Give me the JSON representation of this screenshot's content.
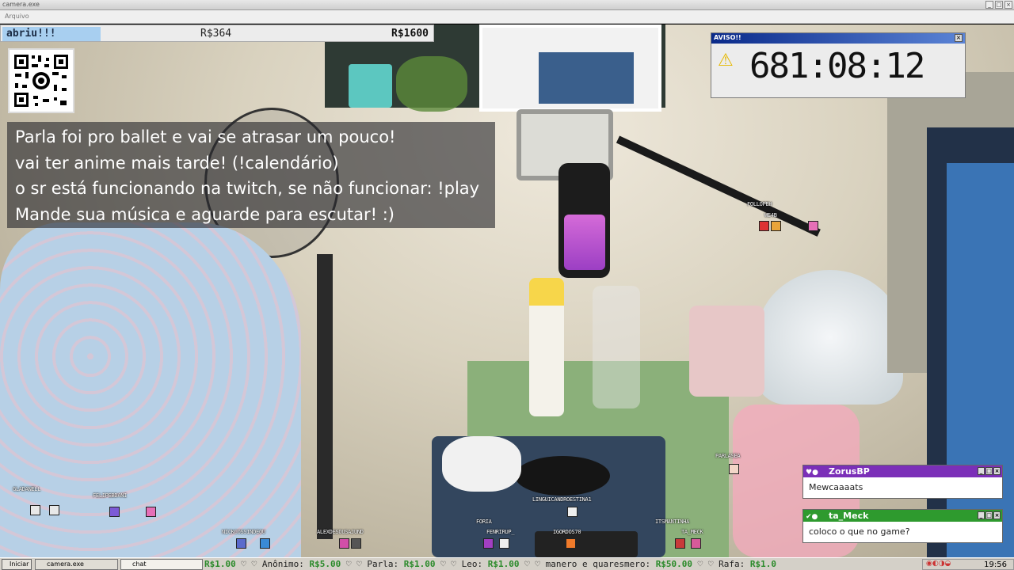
{
  "window": {
    "title": "camera.exe",
    "menu_label": "Arquivo"
  },
  "stream_bar": {
    "label": "abriu!!!",
    "value_1": "R$364",
    "value_2": "R$1600"
  },
  "info_lines": [
    "Parla foi pro ballet e vai se atrasar um pouco!",
    "vai ter anime mais tarde! (!calendário)",
    "o sr está funcionando na twitch, se não funcionar: !play",
    "Mande sua música e aguarde para escutar! :)"
  ],
  "aviso": {
    "title": "AVISO!!",
    "timer": "681:08:12"
  },
  "chats": [
    {
      "user": "ZorusBP",
      "message": "Mewcaaaats",
      "color": "#7b2fb8"
    },
    {
      "user": "ta_Meck",
      "message": "coloco o que no game?",
      "color": "#2e9a2e"
    }
  ],
  "viewers": [
    {
      "name": "FOLLOPEH"
    },
    {
      "name": "WE4B"
    },
    {
      "name": "PARLASEA"
    },
    {
      "name": "GLADANELL"
    },
    {
      "name": "FELIPEBDANI"
    },
    {
      "name": "NICKCOSSINDEOU"
    },
    {
      "name": "ALEXDESOUSAJUND"
    },
    {
      "name": "FORIA"
    },
    {
      "name": "FENRIRUP_"
    },
    {
      "name": "LINGUICANDROESTINA1"
    },
    {
      "name": "IGORDOS70"
    },
    {
      "name": "ITSMANTINHA"
    },
    {
      "name": "TA_MECK"
    }
  ],
  "taskbar": {
    "start_label": "Iniciar",
    "buttons": [
      "camera.exe",
      "chat"
    ],
    "ticker_items": [
      {
        "name": "",
        "amount": "R$1.00"
      },
      {
        "name": "Anônimo:",
        "amount": "R$5.00"
      },
      {
        "name": "Parla:",
        "amount": "R$1.00"
      },
      {
        "name": "Leo:",
        "amount": "R$1.00"
      },
      {
        "name": "manero e quaresmero:",
        "amount": "R$50.00"
      },
      {
        "name": "Rafa:",
        "amount": "R$1.0"
      }
    ],
    "clock": "19:56"
  },
  "colors": {
    "accent_blue": "#a8cff0",
    "aviso_bar": "#0a2a8a",
    "ticker_amount": "#2a8a2a"
  }
}
